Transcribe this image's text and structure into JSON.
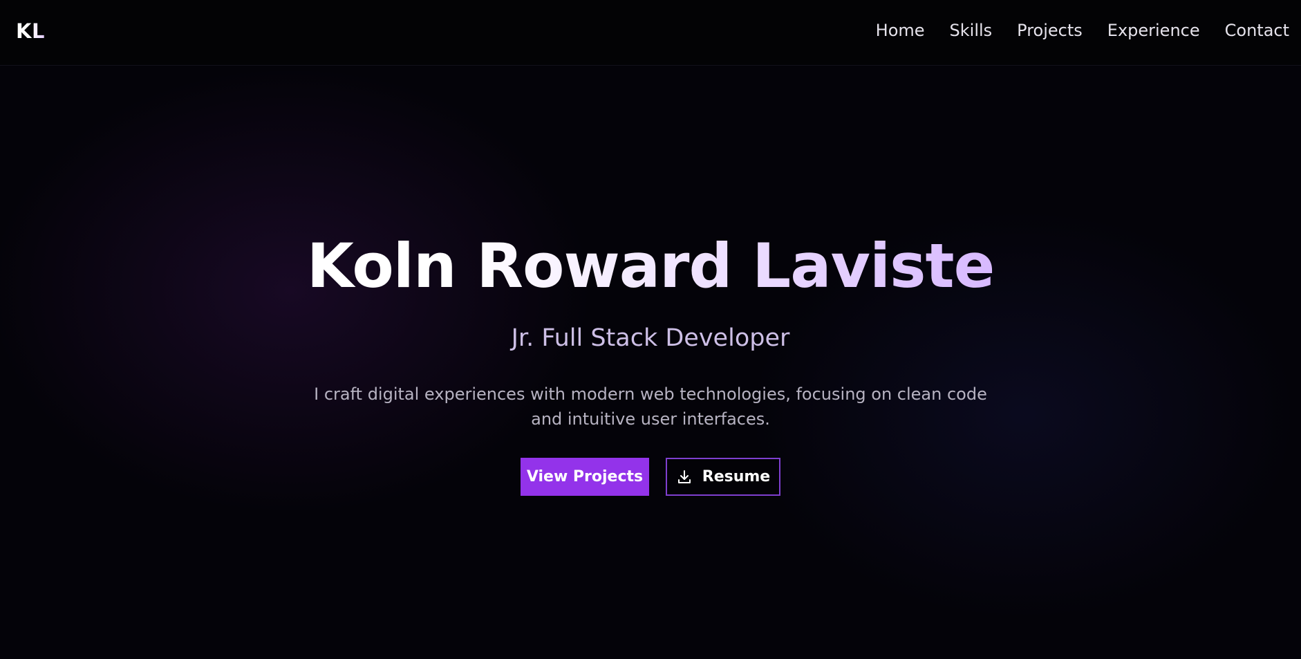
{
  "nav": {
    "logo": "KL",
    "links": [
      "Home",
      "Skills",
      "Projects",
      "Experience",
      "Contact"
    ]
  },
  "hero": {
    "name": "Koln Roward Laviste",
    "role": "Jr. Full Stack Developer",
    "description": "I craft digital experiences with modern web technologies, focusing on clean code and intuitive user interfaces.",
    "primary_button": "View Projects",
    "secondary_button": "Resume",
    "secondary_button_icon": "download-icon"
  },
  "colors": {
    "background": "#040309",
    "accent": "#9333ea",
    "accent_border": "#7e3fcf",
    "gradient_end": "#c9a4ff"
  }
}
